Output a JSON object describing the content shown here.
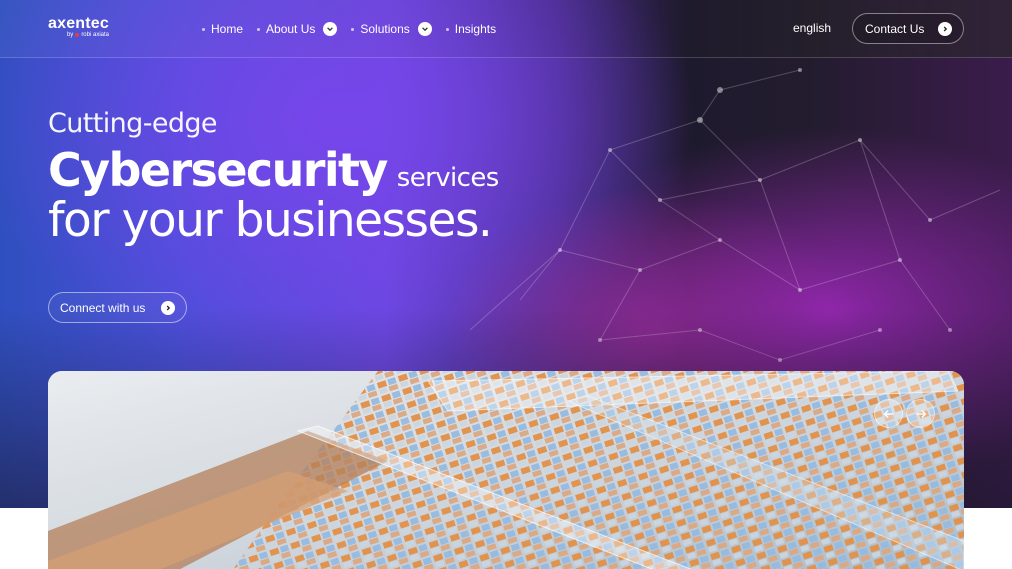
{
  "brand": {
    "name": "axentec",
    "byline": "by",
    "partner": "robi axiata"
  },
  "nav": {
    "items": [
      {
        "label": "Home",
        "has_dropdown": false
      },
      {
        "label": "About Us",
        "has_dropdown": true
      },
      {
        "label": "Solutions",
        "has_dropdown": true
      },
      {
        "label": "Insights",
        "has_dropdown": false
      }
    ],
    "language": "english",
    "contact_label": "Contact Us"
  },
  "hero": {
    "line1": "Cutting-edge",
    "line2_strong": "Cybersecurity",
    "line2_small": "services",
    "line3": "for your businesses.",
    "cta_label": "Connect with us"
  },
  "carousel": {
    "prev_icon": "arrow-left-icon",
    "next_icon": "arrow-right-icon"
  },
  "colors": {
    "accent_purple": "#6a47e0",
    "accent_blue": "#2f4fbf",
    "accent_magenta": "#a028be",
    "logo_dot": "#e23b4f"
  }
}
